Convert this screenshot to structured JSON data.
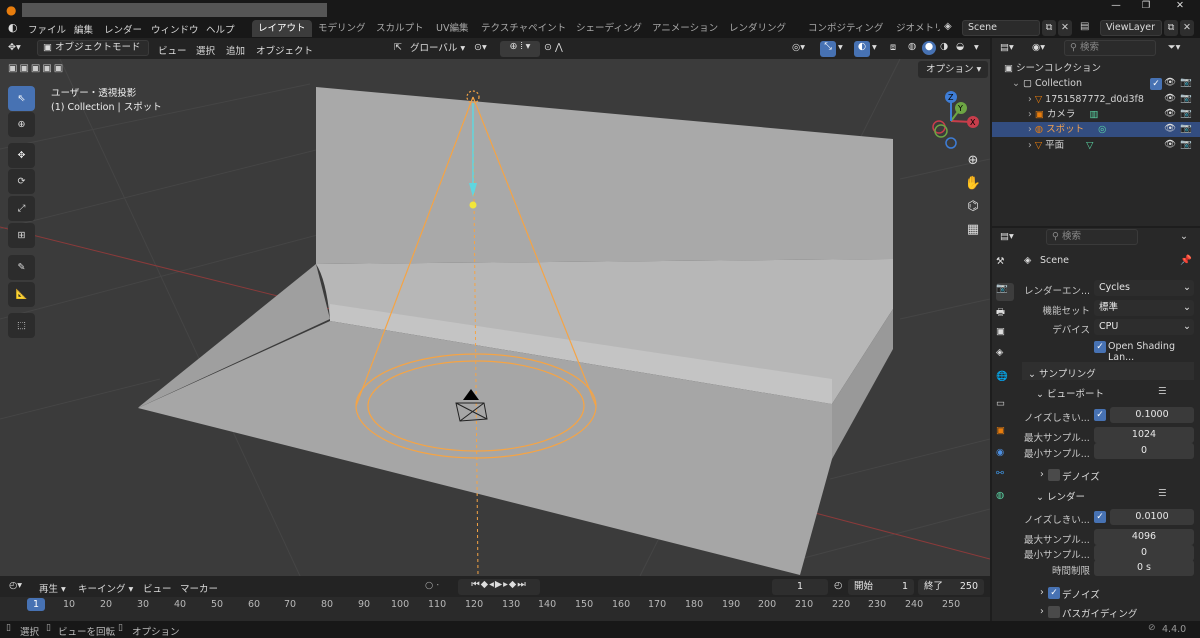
{
  "topbar": {
    "menus": [
      "ファイル",
      "編集",
      "レンダー",
      "ウィンドウ",
      "ヘルプ"
    ],
    "workspaces": [
      "レイアウト",
      "モデリング",
      "スカルプト",
      "UV編集",
      "テクスチャペイント",
      "シェーディング",
      "アニメーション",
      "レンダリング",
      "コンポジティング",
      "ジオメトリ..."
    ],
    "scene": "Scene",
    "view_layer": "ViewLayer"
  },
  "viewport_header": {
    "mode": "オブジェクトモード",
    "menus": [
      "ビュー",
      "選択",
      "追加",
      "オブジェクト"
    ],
    "orientation": "グローバル",
    "options": "オプション"
  },
  "viewport": {
    "view_name": "ユーザー・透視投影",
    "context": "(1) Collection | スポット",
    "axes": {
      "x": "X",
      "y": "Y",
      "z": "Z"
    }
  },
  "timeline_header": {
    "menus": [
      "再生",
      "キーイング",
      "ビュー",
      "マーカー"
    ],
    "current_frame": "1",
    "start_label": "開始",
    "start": "1",
    "end_label": "終了",
    "end": "250"
  },
  "timeline": {
    "frames": [
      "1",
      "10",
      "20",
      "30",
      "40",
      "50",
      "60",
      "70",
      "80",
      "90",
      "100",
      "110",
      "120",
      "130",
      "140",
      "150",
      "160",
      "170",
      "180",
      "190",
      "200",
      "210",
      "220",
      "230",
      "240",
      "250"
    ]
  },
  "status": {
    "items": [
      "選択",
      "ビューを回転",
      "オプション"
    ],
    "version": "4.4.0"
  },
  "outliner": {
    "search_placeholder": "検索",
    "root": "シーンコレクション",
    "collection": "Collection",
    "items": [
      {
        "name": "1751587772_d0d3f8"
      },
      {
        "name": "カメラ"
      },
      {
        "name": "スポット"
      },
      {
        "name": "平面"
      }
    ]
  },
  "properties": {
    "search_placeholder": "検索",
    "scene": "Scene",
    "render_engine_label": "レンダーエン...",
    "render_engine": "Cycles",
    "feature_set_label": "機能セット",
    "feature_set": "標準",
    "device_label": "デバイス",
    "device": "CPU",
    "osl_label": "Open Shading Lan...",
    "sampling": "サンプリング",
    "viewport": "ビューポート",
    "vp_noise_label": "ノイズしきい...",
    "vp_noise": "0.1000",
    "vp_max_label": "最大サンプル...",
    "vp_max": "1024",
    "vp_min_label": "最小サンプル...",
    "vp_min": "0",
    "vp_denoise": "デノイズ",
    "render": "レンダー",
    "r_noise_label": "ノイズしきい...",
    "r_noise": "0.0100",
    "r_max_label": "最大サンプル...",
    "r_max": "4096",
    "r_min_label": "最小サンプル...",
    "r_min": "0",
    "r_time_label": "時間制限",
    "r_time": "0 s",
    "r_denoise": "デノイズ",
    "path_guiding": "パスガイディング"
  },
  "colors": {
    "accent": "#4772b3",
    "light": "#f5a445",
    "bg": "#1d1d1d"
  }
}
